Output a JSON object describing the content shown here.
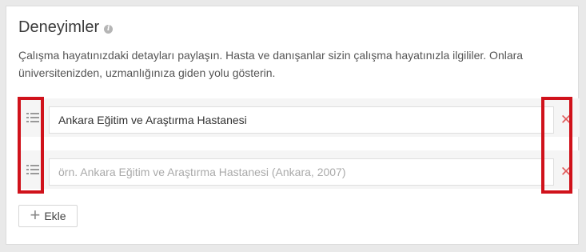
{
  "section": {
    "title": "Deneyimler",
    "info_icon": "info-icon",
    "description": "Çalışma hayatınızdaki detayları paylaşın. Hasta ve danışanlar sizin çalışma hayatınızla ilgililer. Onlara üniversitenizden, uzmanlığınıza giden yolu gösterin."
  },
  "entries": [
    {
      "value": "Ankara Eğitim ve Araştırma Hastanesi",
      "placeholder": "",
      "drag_icon": "drag-handle-icon",
      "remove_icon": "close-icon"
    },
    {
      "value": "",
      "placeholder": "örn. Ankara Eğitim ve Araştırma Hastanesi (Ankara, 2007)",
      "drag_icon": "drag-handle-icon",
      "remove_icon": "close-icon"
    }
  ],
  "add_button": {
    "label": "Ekle",
    "icon": "plus-icon"
  },
  "colors": {
    "highlight": "#d0121b",
    "remove": "#e05a5a"
  }
}
